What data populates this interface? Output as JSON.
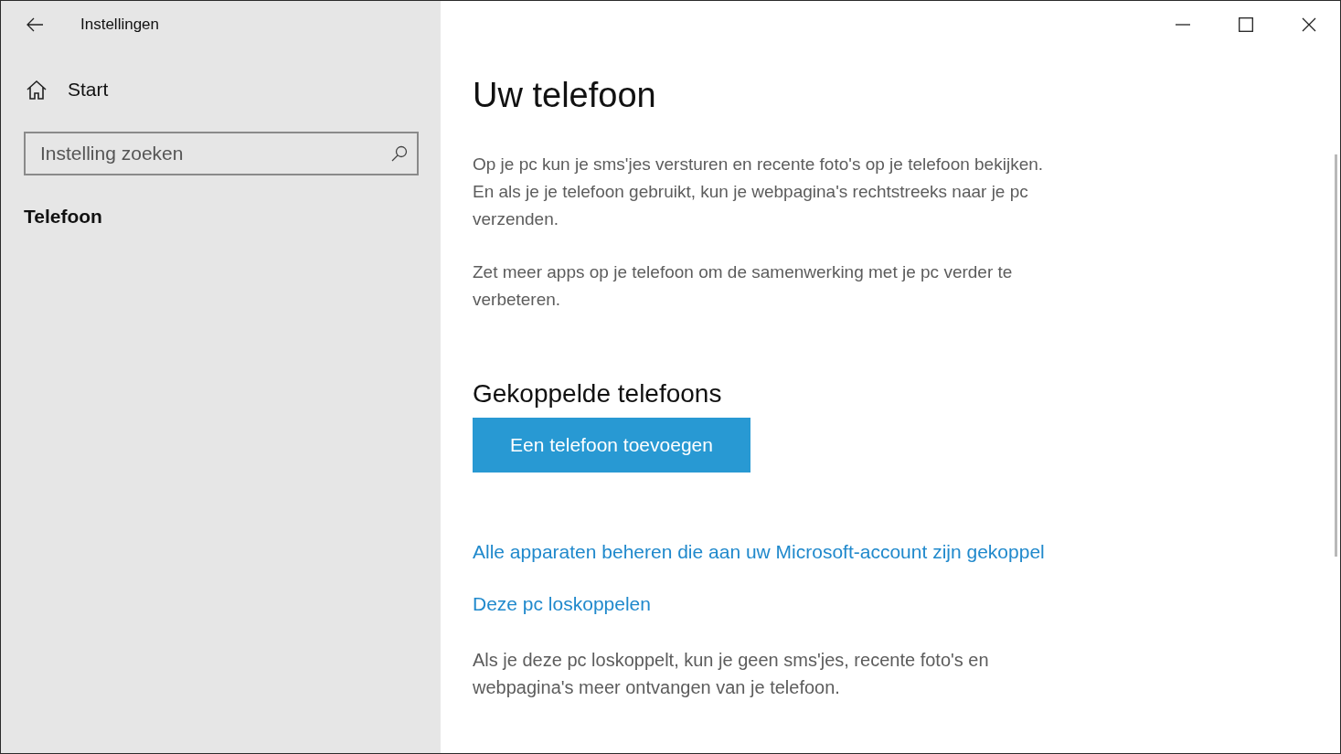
{
  "window": {
    "title": "Instellingen"
  },
  "sidebar": {
    "home": "Start",
    "search": {
      "placeholder": "Instelling zoeken"
    },
    "items": [
      {
        "label": "Telefoon",
        "selected": true
      }
    ]
  },
  "content": {
    "title": "Uw telefoon",
    "paragraphs": [
      "Op je pc kun je sms'jes versturen en recente foto's op je telefoon bekijken. En als je je telefoon gebruikt, kun je webpagina's rechtstreeks naar je pc verzenden.",
      "Zet meer apps op je telefoon om de samenwerking met je pc verder te verbeteren."
    ],
    "section_title": "Gekoppelde telefoons",
    "button": "Een telefoon toevoegen",
    "links": [
      "Alle apparaten beheren die aan uw Microsoft-account zijn gekoppel",
      "Deze pc loskoppelen"
    ],
    "note": "Als je deze pc loskoppelt, kun je geen sms'jes, recente foto's en webpagina's meer ontvangen van je telefoon."
  }
}
